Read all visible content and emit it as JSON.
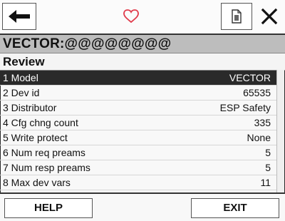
{
  "toolbar": {
    "back_icon": "arrow-left-icon",
    "favorite_icon": "heart-outline-icon",
    "document_icon": "document-icon",
    "close_icon": "close-x-icon",
    "accent_heart": "#e03a4a"
  },
  "title": "VECTOR:@@@@@@@@",
  "header": "Review",
  "rows": [
    {
      "label": "1 Model",
      "value": "VECTOR",
      "selected": true
    },
    {
      "label": "2 Dev id",
      "value": "65535"
    },
    {
      "label": "3 Distributor",
      "value": "ESP Safety"
    },
    {
      "label": "4 Cfg chng count",
      "value": "335"
    },
    {
      "label": "5 Write protect",
      "value": "None"
    },
    {
      "label": "6 Num req preams",
      "value": "5"
    },
    {
      "label": "7 Num resp preams",
      "value": "5"
    },
    {
      "label": "8 Max dev vars",
      "value": "11"
    }
  ],
  "buttons": {
    "help": "HELP",
    "exit": "EXIT"
  }
}
